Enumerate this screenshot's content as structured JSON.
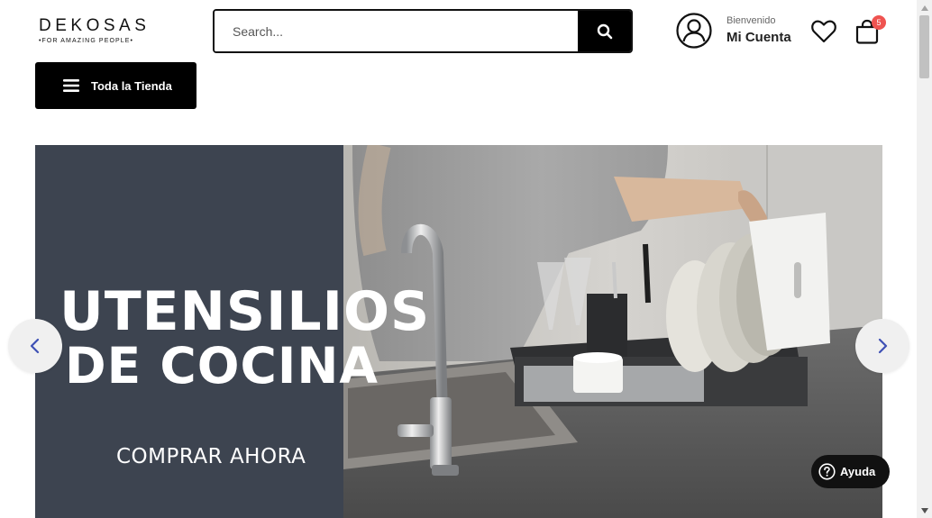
{
  "header": {
    "logo_main": "DEKOSAS",
    "logo_sub": "•FOR AMAZING PEOPLE•",
    "search_placeholder": "Search...",
    "search_icon": "search-icon",
    "account_greeting": "Bienvenido",
    "account_title": "Mi Cuenta",
    "account_icon": "user-icon",
    "wishlist_icon": "heart-icon",
    "cart_icon": "bag-icon",
    "cart_count": "5"
  },
  "nav": {
    "store_button_label": "Toda la Tienda",
    "store_button_icon": "menu-icon"
  },
  "banner": {
    "title_line1": "UTENSILIOS",
    "title_line2": "DE COCINA",
    "cta": "COMPRAR AHORA",
    "panel_color": "#3d4450",
    "prev_icon": "chevron-left-icon",
    "next_icon": "chevron-right-icon"
  },
  "help": {
    "label": "Ayuda",
    "icon": "question-circle-icon"
  },
  "colors": {
    "primary": "#000000",
    "badge": "#ef5350",
    "arrow": "#3f51b5"
  }
}
